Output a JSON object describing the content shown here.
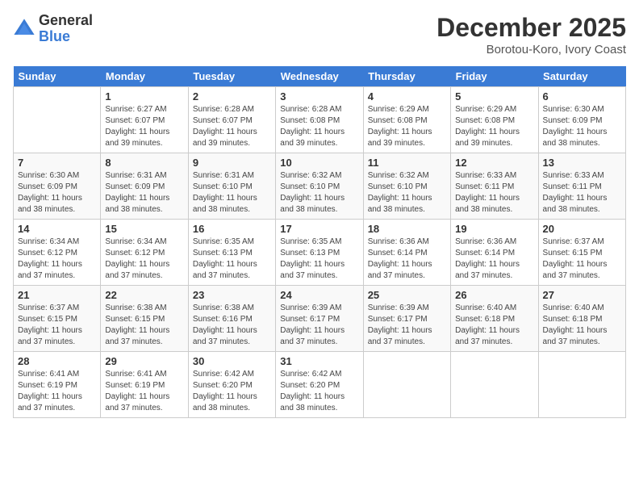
{
  "logo": {
    "general": "General",
    "blue": "Blue"
  },
  "title": "December 2025",
  "location": "Borotou-Koro, Ivory Coast",
  "days_of_week": [
    "Sunday",
    "Monday",
    "Tuesday",
    "Wednesday",
    "Thursday",
    "Friday",
    "Saturday"
  ],
  "weeks": [
    [
      {
        "day": "",
        "info": ""
      },
      {
        "day": "1",
        "info": "Sunrise: 6:27 AM\nSunset: 6:07 PM\nDaylight: 11 hours\nand 39 minutes."
      },
      {
        "day": "2",
        "info": "Sunrise: 6:28 AM\nSunset: 6:07 PM\nDaylight: 11 hours\nand 39 minutes."
      },
      {
        "day": "3",
        "info": "Sunrise: 6:28 AM\nSunset: 6:08 PM\nDaylight: 11 hours\nand 39 minutes."
      },
      {
        "day": "4",
        "info": "Sunrise: 6:29 AM\nSunset: 6:08 PM\nDaylight: 11 hours\nand 39 minutes."
      },
      {
        "day": "5",
        "info": "Sunrise: 6:29 AM\nSunset: 6:08 PM\nDaylight: 11 hours\nand 39 minutes."
      },
      {
        "day": "6",
        "info": "Sunrise: 6:30 AM\nSunset: 6:09 PM\nDaylight: 11 hours\nand 38 minutes."
      }
    ],
    [
      {
        "day": "7",
        "info": "Sunrise: 6:30 AM\nSunset: 6:09 PM\nDaylight: 11 hours\nand 38 minutes."
      },
      {
        "day": "8",
        "info": "Sunrise: 6:31 AM\nSunset: 6:09 PM\nDaylight: 11 hours\nand 38 minutes."
      },
      {
        "day": "9",
        "info": "Sunrise: 6:31 AM\nSunset: 6:10 PM\nDaylight: 11 hours\nand 38 minutes."
      },
      {
        "day": "10",
        "info": "Sunrise: 6:32 AM\nSunset: 6:10 PM\nDaylight: 11 hours\nand 38 minutes."
      },
      {
        "day": "11",
        "info": "Sunrise: 6:32 AM\nSunset: 6:10 PM\nDaylight: 11 hours\nand 38 minutes."
      },
      {
        "day": "12",
        "info": "Sunrise: 6:33 AM\nSunset: 6:11 PM\nDaylight: 11 hours\nand 38 minutes."
      },
      {
        "day": "13",
        "info": "Sunrise: 6:33 AM\nSunset: 6:11 PM\nDaylight: 11 hours\nand 38 minutes."
      }
    ],
    [
      {
        "day": "14",
        "info": "Sunrise: 6:34 AM\nSunset: 6:12 PM\nDaylight: 11 hours\nand 37 minutes."
      },
      {
        "day": "15",
        "info": "Sunrise: 6:34 AM\nSunset: 6:12 PM\nDaylight: 11 hours\nand 37 minutes."
      },
      {
        "day": "16",
        "info": "Sunrise: 6:35 AM\nSunset: 6:13 PM\nDaylight: 11 hours\nand 37 minutes."
      },
      {
        "day": "17",
        "info": "Sunrise: 6:35 AM\nSunset: 6:13 PM\nDaylight: 11 hours\nand 37 minutes."
      },
      {
        "day": "18",
        "info": "Sunrise: 6:36 AM\nSunset: 6:14 PM\nDaylight: 11 hours\nand 37 minutes."
      },
      {
        "day": "19",
        "info": "Sunrise: 6:36 AM\nSunset: 6:14 PM\nDaylight: 11 hours\nand 37 minutes."
      },
      {
        "day": "20",
        "info": "Sunrise: 6:37 AM\nSunset: 6:15 PM\nDaylight: 11 hours\nand 37 minutes."
      }
    ],
    [
      {
        "day": "21",
        "info": "Sunrise: 6:37 AM\nSunset: 6:15 PM\nDaylight: 11 hours\nand 37 minutes."
      },
      {
        "day": "22",
        "info": "Sunrise: 6:38 AM\nSunset: 6:15 PM\nDaylight: 11 hours\nand 37 minutes."
      },
      {
        "day": "23",
        "info": "Sunrise: 6:38 AM\nSunset: 6:16 PM\nDaylight: 11 hours\nand 37 minutes."
      },
      {
        "day": "24",
        "info": "Sunrise: 6:39 AM\nSunset: 6:17 PM\nDaylight: 11 hours\nand 37 minutes."
      },
      {
        "day": "25",
        "info": "Sunrise: 6:39 AM\nSunset: 6:17 PM\nDaylight: 11 hours\nand 37 minutes."
      },
      {
        "day": "26",
        "info": "Sunrise: 6:40 AM\nSunset: 6:18 PM\nDaylight: 11 hours\nand 37 minutes."
      },
      {
        "day": "27",
        "info": "Sunrise: 6:40 AM\nSunset: 6:18 PM\nDaylight: 11 hours\nand 37 minutes."
      }
    ],
    [
      {
        "day": "28",
        "info": "Sunrise: 6:41 AM\nSunset: 6:19 PM\nDaylight: 11 hours\nand 37 minutes."
      },
      {
        "day": "29",
        "info": "Sunrise: 6:41 AM\nSunset: 6:19 PM\nDaylight: 11 hours\nand 37 minutes."
      },
      {
        "day": "30",
        "info": "Sunrise: 6:42 AM\nSunset: 6:20 PM\nDaylight: 11 hours\nand 38 minutes."
      },
      {
        "day": "31",
        "info": "Sunrise: 6:42 AM\nSunset: 6:20 PM\nDaylight: 11 hours\nand 38 minutes."
      },
      {
        "day": "",
        "info": ""
      },
      {
        "day": "",
        "info": ""
      },
      {
        "day": "",
        "info": ""
      }
    ]
  ]
}
